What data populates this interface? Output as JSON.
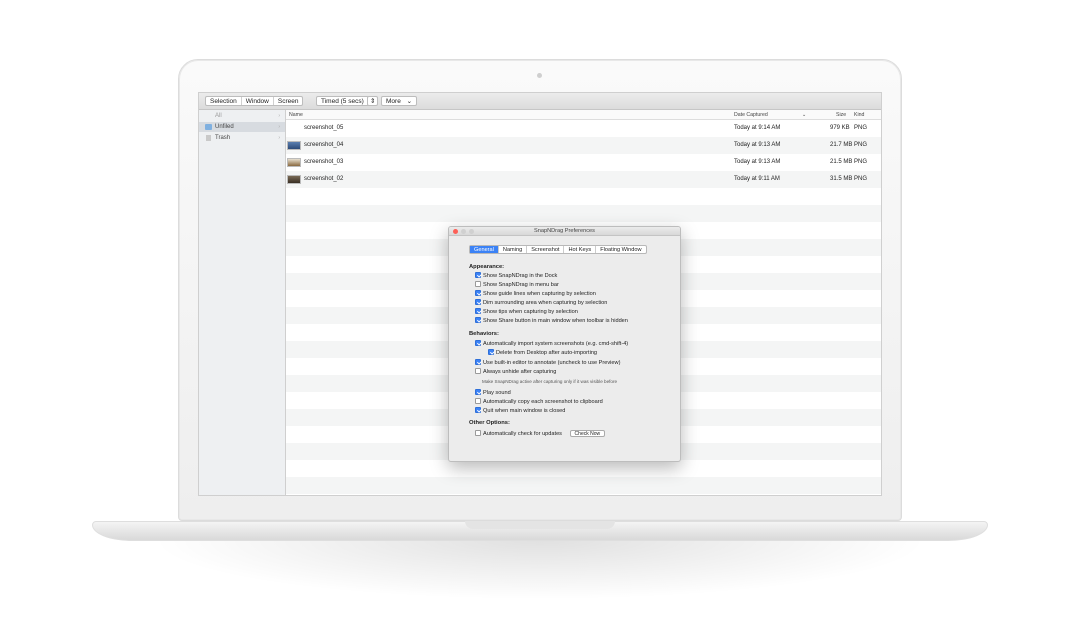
{
  "toolbar": {
    "capture_modes": [
      "Selection",
      "Window",
      "Screen"
    ],
    "timed_label": "Timed (5 secs)",
    "more_label": "More"
  },
  "sidebar": {
    "items": [
      {
        "label": "All"
      },
      {
        "label": "Unfiled"
      },
      {
        "label": "Trash"
      }
    ]
  },
  "list": {
    "columns": {
      "name": "Name",
      "date": "Date Captured",
      "size": "Size",
      "kind": "Kind"
    },
    "rows": [
      {
        "name": "screenshot_05",
        "date": "Today at 9:14 AM",
        "size": "979 KB",
        "kind": "PNG"
      },
      {
        "name": "screenshot_04",
        "date": "Today at 9:13 AM",
        "size": "21.7 MB",
        "kind": "PNG"
      },
      {
        "name": "screenshot_03",
        "date": "Today at 9:13 AM",
        "size": "21.5 MB",
        "kind": "PNG"
      },
      {
        "name": "screenshot_02",
        "date": "Today at 9:11 AM",
        "size": "31.5 MB",
        "kind": "PNG"
      }
    ]
  },
  "prefs": {
    "title": "SnapNDrag Preferences",
    "tabs": [
      "General",
      "Naming",
      "Screenshot",
      "Hot Keys",
      "Floating Window"
    ],
    "active_tab": "General",
    "appearance": {
      "heading": "Appearance:",
      "options": [
        {
          "label": "Show SnapNDrag in the Dock",
          "checked": true
        },
        {
          "label": "Show SnapNDrag in menu bar",
          "checked": false
        },
        {
          "label": "Show guide lines when capturing by selection",
          "checked": true
        },
        {
          "label": "Dim surrounding area when capturing by selection",
          "checked": true
        },
        {
          "label": "Show tips when capturing by selection",
          "checked": true
        },
        {
          "label": "Show Share button in main window when toolbar is hidden",
          "checked": true
        }
      ]
    },
    "behaviors": {
      "heading": "Behaviors:",
      "auto_import": "Automatically import system screenshots (e.g. cmd-shift-4)",
      "delete_desktop": "Delete from Desktop after auto-importing",
      "builtin_editor": "Use built-in editor to annotate (uncheck to use Preview)",
      "always_unhide": "Always unhide after capturing",
      "unhide_hint": "Make SnapNDrag active after capturing only if it was visible before",
      "play_sound": "Play sound",
      "auto_copy": "Automatically copy each screenshot to clipboard",
      "quit_closed": "Quit when main window is closed"
    },
    "other": {
      "heading": "Other Options:",
      "check_updates": "Automatically check for updates",
      "check_now": "Check Now"
    }
  },
  "colors": {
    "accent": "#3b82f6",
    "close": "#fd5f57"
  }
}
